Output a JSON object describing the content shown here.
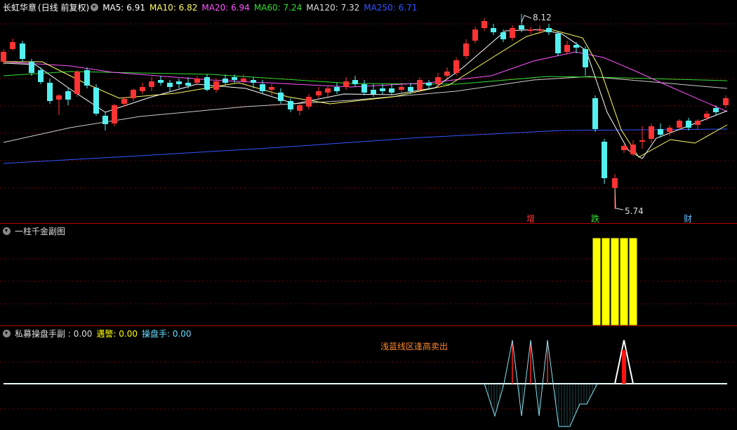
{
  "main": {
    "stock_name": "长虹华意",
    "period_label": "(日线 前复权)",
    "ma": [
      {
        "label": "MA5: 6.91",
        "color": "#ffffff"
      },
      {
        "label": "MA10: 6.82",
        "color": "#ffff66"
      },
      {
        "label": "MA20: 6.94",
        "color": "#ff55ff"
      },
      {
        "label": "MA60: 7.24",
        "color": "#33dd33"
      },
      {
        "label": "MA120: 7.32",
        "color": "#cccccc"
      },
      {
        "label": "MA250: 6.71",
        "color": "#3355ff"
      }
    ],
    "high_label": "8.12",
    "low_label": "5.74",
    "markers": [
      {
        "text": "增",
        "color": "#ff3333"
      },
      {
        "text": "跌",
        "color": "#33dd33"
      },
      {
        "text": "财",
        "color": "#66bbff"
      }
    ],
    "colors": {
      "up": "#ff3333",
      "down": "#54f0f0"
    }
  },
  "sub1": {
    "title": "一柱千金副图",
    "bar_color": "#ffff00"
  },
  "sub2": {
    "title": "私募操盘手副",
    "value_label": " : 0.00",
    "alert_label": "遇警: 0.00",
    "trader_label": "操盘手: 0.00",
    "annotation": "浅蓝线区逢高卖出",
    "annotation_color": "#ff8833"
  }
}
